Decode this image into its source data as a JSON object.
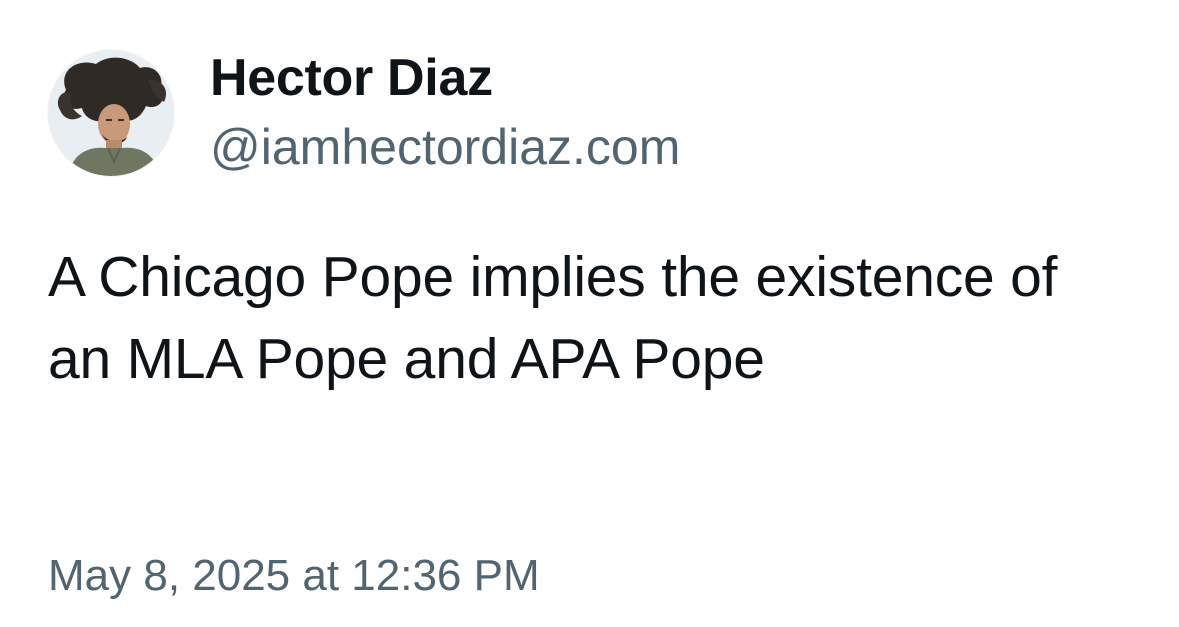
{
  "post": {
    "author": {
      "display_name": "Hector Diaz",
      "handle": "@iamhectordiaz.com",
      "avatar_icon": "profile-photo"
    },
    "text": "A Chicago Pope implies the existence of an MLA Pope and APA Pope",
    "timestamp": "May 8, 2025 at 12:36 PM"
  },
  "colors": {
    "primary_text": "#0f1419",
    "secondary_text": "#536471",
    "background": "#ffffff"
  }
}
